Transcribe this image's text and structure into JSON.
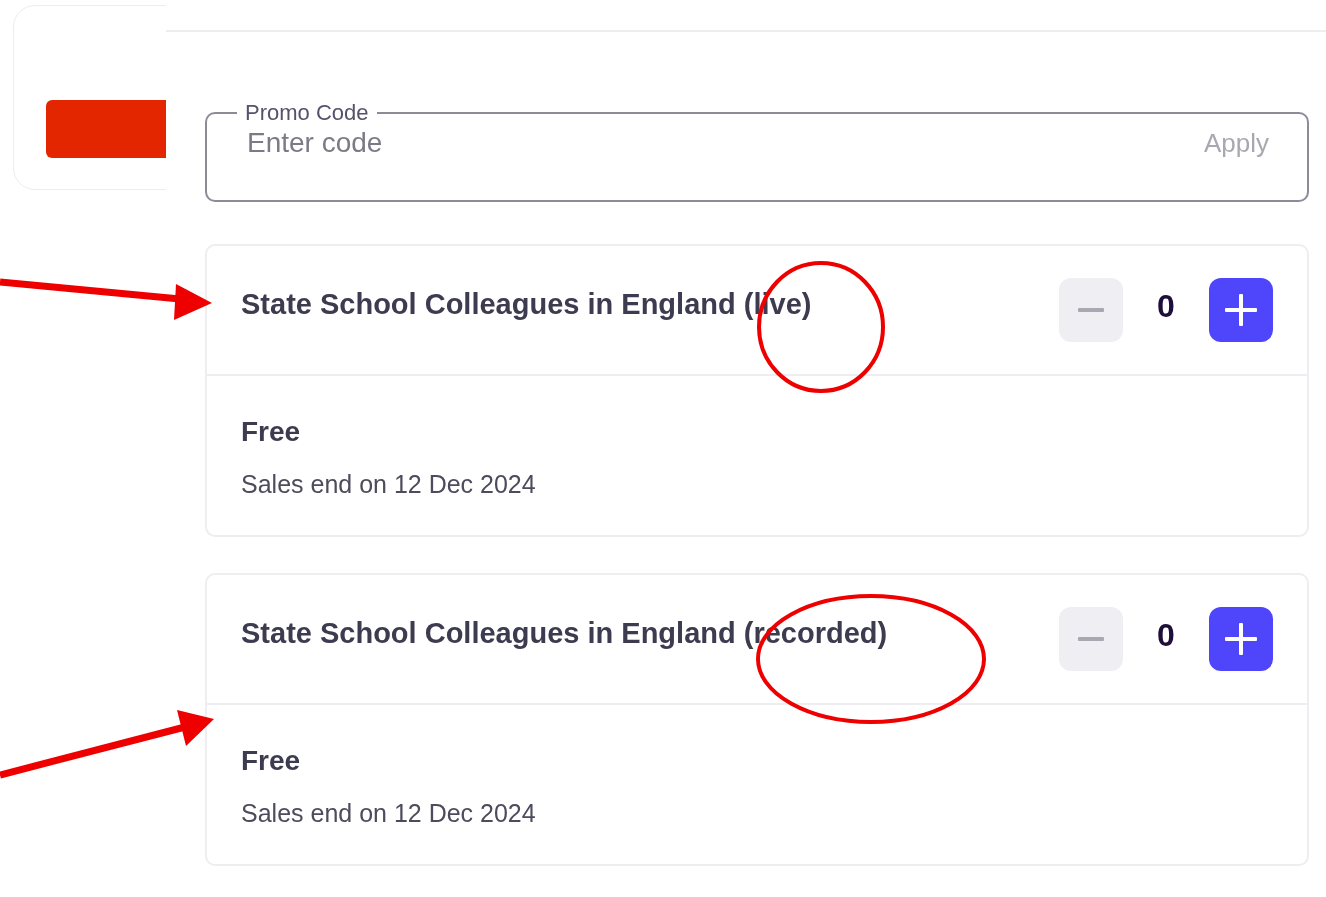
{
  "promo": {
    "label": "Promo Code",
    "placeholder": "Enter code",
    "action": "Apply"
  },
  "tickets": [
    {
      "title": "State School Colleagues in England (live)",
      "quantity": "0",
      "minus_disabled": true,
      "plus_disabled": false,
      "price": "Free",
      "sales_end": "Sales end on 12 Dec 2024"
    },
    {
      "title": "State School Colleagues in England (recorded)",
      "quantity": "0",
      "minus_disabled": true,
      "plus_disabled": false,
      "price": "Free",
      "sales_end": "Sales end on 12 Dec 2024"
    }
  ]
}
